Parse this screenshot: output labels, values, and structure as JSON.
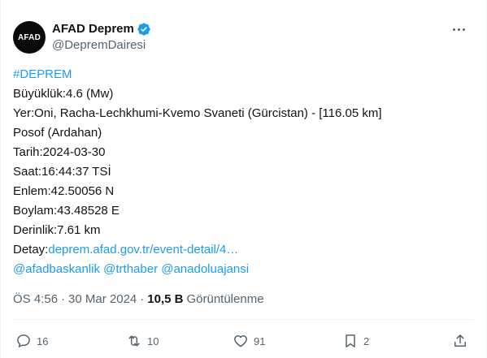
{
  "account": {
    "display_name": "AFAD Deprem",
    "handle": "@DepremDairesi",
    "avatar_text": "AFAD",
    "verified_color": "#1d9bf0"
  },
  "tweet": {
    "hashtag": "#DEPREM",
    "lines": [
      "Büyüklük:4.6 (Mw)",
      "Yer:Oni, Racha-Lechkhumi-Kvemo Svaneti (Gürcistan) - [116.05 km]",
      "Posof (Ardahan)",
      "Tarih:2024-03-30",
      "Saat:16:44:37 TSİ",
      "Enlem:42.50056 N",
      "Boylam:43.48528 E",
      "Derinlik:7.61 km"
    ],
    "detail_label": "Detay:",
    "detail_link": "deprem.afad.gov.tr/event-detail/4…",
    "mentions": [
      "@afadbaskanlik",
      "@trthaber",
      "@anadoluajansi"
    ]
  },
  "meta": {
    "time": "ÖS 4:56",
    "separator": "·",
    "date": "30 Mar 2024",
    "views_count": "10,5 B",
    "views_label": "Görüntülenme"
  },
  "actions": {
    "replies": "16",
    "retweets": "10",
    "likes": "91",
    "bookmarks": "2"
  },
  "colors": {
    "link": "#1d9bf0",
    "secondary_text": "#536471",
    "primary_text": "#0f1419"
  }
}
